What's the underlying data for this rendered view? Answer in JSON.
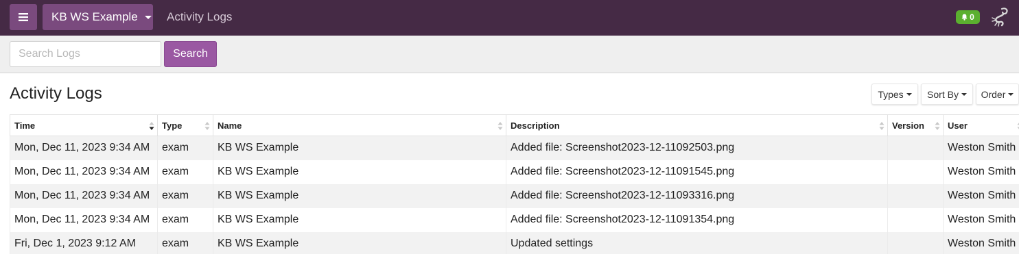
{
  "topbar": {
    "workspace_label": "KB WS Example",
    "page_label": "Activity Logs",
    "notification_count": "0",
    "colors": {
      "bar": "#452a45",
      "button": "#7a4a7e",
      "badge": "#5bb02f"
    }
  },
  "search": {
    "placeholder": "Search Logs",
    "value": "",
    "button_label": "Search"
  },
  "main": {
    "title": "Activity Logs",
    "filters": [
      {
        "label": "Types"
      },
      {
        "label": "Sort By"
      },
      {
        "label": "Order"
      }
    ]
  },
  "table": {
    "columns": [
      "Time",
      "Type",
      "Name",
      "Description",
      "Version",
      "User"
    ],
    "sorted_column": "Time",
    "sort_direction": "descending",
    "rows": [
      {
        "time": "Mon, Dec 11, 2023 9:34 AM",
        "type": "exam",
        "name": "KB WS Example",
        "description": "Added file: Screenshot2023-12-11092503.png",
        "version": "",
        "user": "Weston Smith"
      },
      {
        "time": "Mon, Dec 11, 2023 9:34 AM",
        "type": "exam",
        "name": "KB WS Example",
        "description": "Added file: Screenshot2023-12-11091545.png",
        "version": "",
        "user": "Weston Smith"
      },
      {
        "time": "Mon, Dec 11, 2023 9:34 AM",
        "type": "exam",
        "name": "KB WS Example",
        "description": "Added file: Screenshot2023-12-11093316.png",
        "version": "",
        "user": "Weston Smith"
      },
      {
        "time": "Mon, Dec 11, 2023 9:34 AM",
        "type": "exam",
        "name": "KB WS Example",
        "description": "Added file: Screenshot2023-12-11091354.png",
        "version": "",
        "user": "Weston Smith"
      },
      {
        "time": "Fri, Dec 1, 2023 9:12 AM",
        "type": "exam",
        "name": "KB WS Example",
        "description": "Updated settings",
        "version": "",
        "user": "Weston Smith"
      }
    ]
  }
}
